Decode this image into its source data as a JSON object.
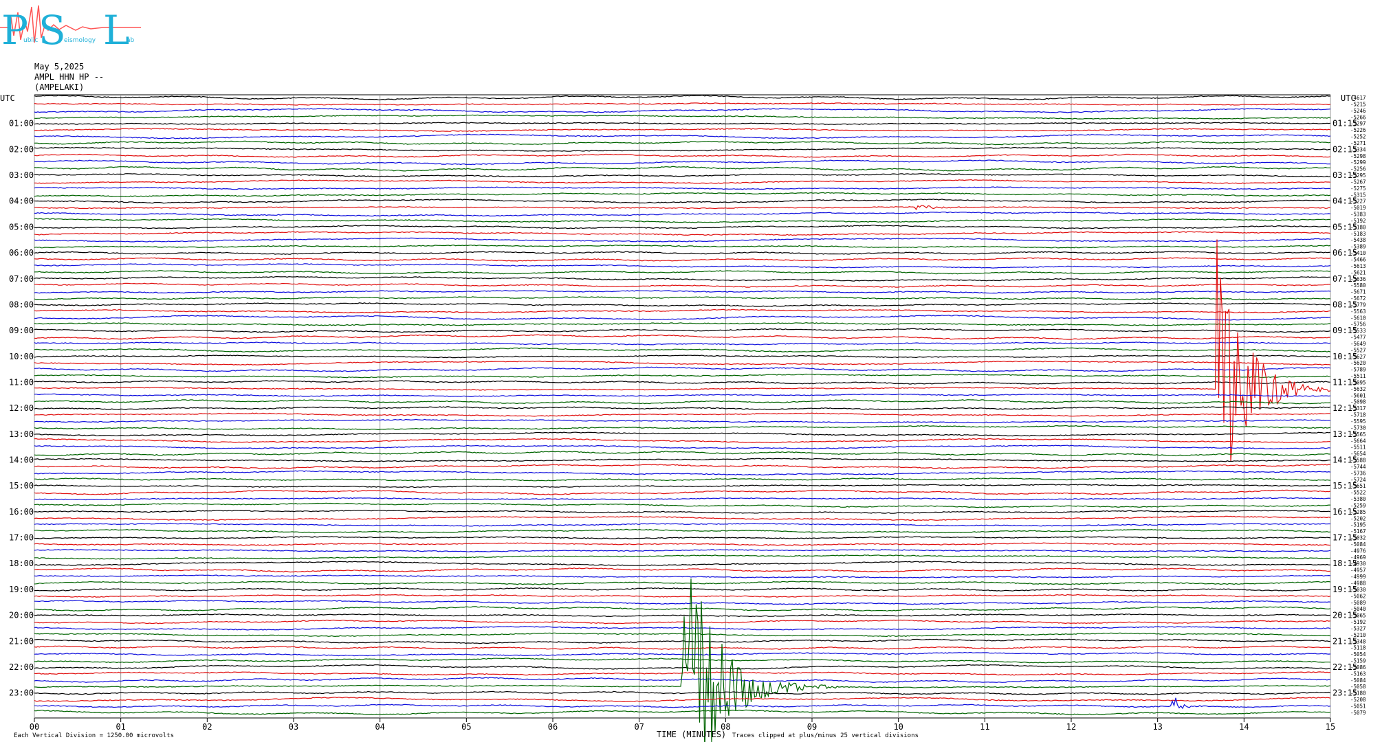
{
  "logo": {
    "big_letters": [
      "P",
      "S",
      "L"
    ],
    "small_words": [
      "ublic",
      "eismology",
      "ab"
    ]
  },
  "header": {
    "date": "May 5,2025",
    "station": "AMPL HHN HP --",
    "site": "(AMPELAKI)"
  },
  "footer": {
    "scale": "Each Vertical Division = 1250.00 microvolts",
    "xlabel": "TIME (MINUTES)",
    "clip": "Traces clipped at plus/minus 25 vertical divisions"
  },
  "chart_data": {
    "type": "line",
    "title": "",
    "xlabel": "TIME (MINUTES)",
    "ylabel": "UTC",
    "xlim": [
      0,
      15
    ],
    "x_ticks": [
      "00",
      "01",
      "02",
      "03",
      "04",
      "05",
      "06",
      "07",
      "08",
      "09",
      "10",
      "11",
      "12",
      "13",
      "14",
      "15"
    ],
    "left_axis_label": "UTC",
    "right_axis_label": "UTC",
    "left_hour_labels": [
      "01:00",
      "02:00",
      "03:00",
      "04:00",
      "05:00",
      "06:00",
      "07:00",
      "08:00",
      "09:00",
      "10:00",
      "11:00",
      "12:00",
      "13:00",
      "14:00",
      "15:00",
      "16:00",
      "17:00",
      "18:00",
      "19:00",
      "20:00",
      "21:00",
      "22:00",
      "23:00"
    ],
    "right_hour_labels": [
      "01:15",
      "02:15",
      "03:15",
      "04:15",
      "05:15",
      "06:15",
      "07:15",
      "08:15",
      "09:15",
      "10:15",
      "11:15",
      "12:15",
      "13:15",
      "14:15",
      "15:15",
      "16:15",
      "17:15",
      "18:15",
      "19:15",
      "20:15",
      "21:15",
      "22:15",
      "23:15"
    ],
    "trace_colors": [
      "#000000",
      "#e01010",
      "#1010dd",
      "#006400"
    ],
    "trace_count": 96,
    "trace_offsets": [
      "-4617",
      "-5215",
      "-5246",
      "-5266",
      "-5297",
      "-5226",
      "-5252",
      "-5271",
      "-5334",
      "-5298",
      "-5299",
      "-5256",
      "-5295",
      "-5267",
      "-5275",
      "-5315",
      "-5227",
      "-5019",
      "-5383",
      "-5192",
      "-5180",
      "-5183",
      "-5438",
      "-5389",
      "-5410",
      "-5466",
      "-5613",
      "-5621",
      "-5636",
      "-5580",
      "-5671",
      "-5672",
      "-5779",
      "-5563",
      "-5610",
      "-5756",
      "-5533",
      "-5477",
      "-5649",
      "-5527",
      "-5627",
      "-5620",
      "-5789",
      "-5511",
      "-5095",
      "-5632",
      "-5601",
      "-5098",
      "-5317",
      "-5718",
      "-5595",
      "-5730",
      "-5565",
      "-5664",
      "-5511",
      "-5654",
      "-5588",
      "-5744",
      "-5736",
      "-5724",
      "-5651",
      "-5522",
      "-5380",
      "-5259",
      "-5285",
      "-5202",
      "-5195",
      "-5167",
      "-5032",
      "-5084",
      "-4976",
      "-4969",
      "-4930",
      "-4957",
      "-4999",
      "-4988",
      "-5030",
      "-5062",
      "-5089",
      "-5040",
      "-5065",
      "-5192",
      "-5327",
      "-5210",
      "-5348",
      "-5118",
      "-5054",
      "-5159",
      "-5086",
      "-5163",
      "-5084",
      "-5058",
      "-5180",
      "-5208",
      "-5051",
      "-5079"
    ],
    "events": [
      {
        "trace_index": 17,
        "start_minute": 10.2,
        "duration_minutes": 1.3,
        "peak_divisions": 0.4
      },
      {
        "trace_index": 44,
        "start_minute": 13.2,
        "duration_minutes": 0.15,
        "peak_divisions": 1.0
      },
      {
        "trace_index": 45,
        "start_minute": 13.68,
        "duration_minutes": 1.5,
        "peak_divisions": 25
      },
      {
        "trace_index": 91,
        "start_minute": 7.5,
        "duration_minutes": 1.8,
        "peak_divisions": 25
      },
      {
        "trace_index": 94,
        "start_minute": 13.15,
        "duration_minutes": 0.4,
        "peak_divisions": 4
      }
    ]
  }
}
